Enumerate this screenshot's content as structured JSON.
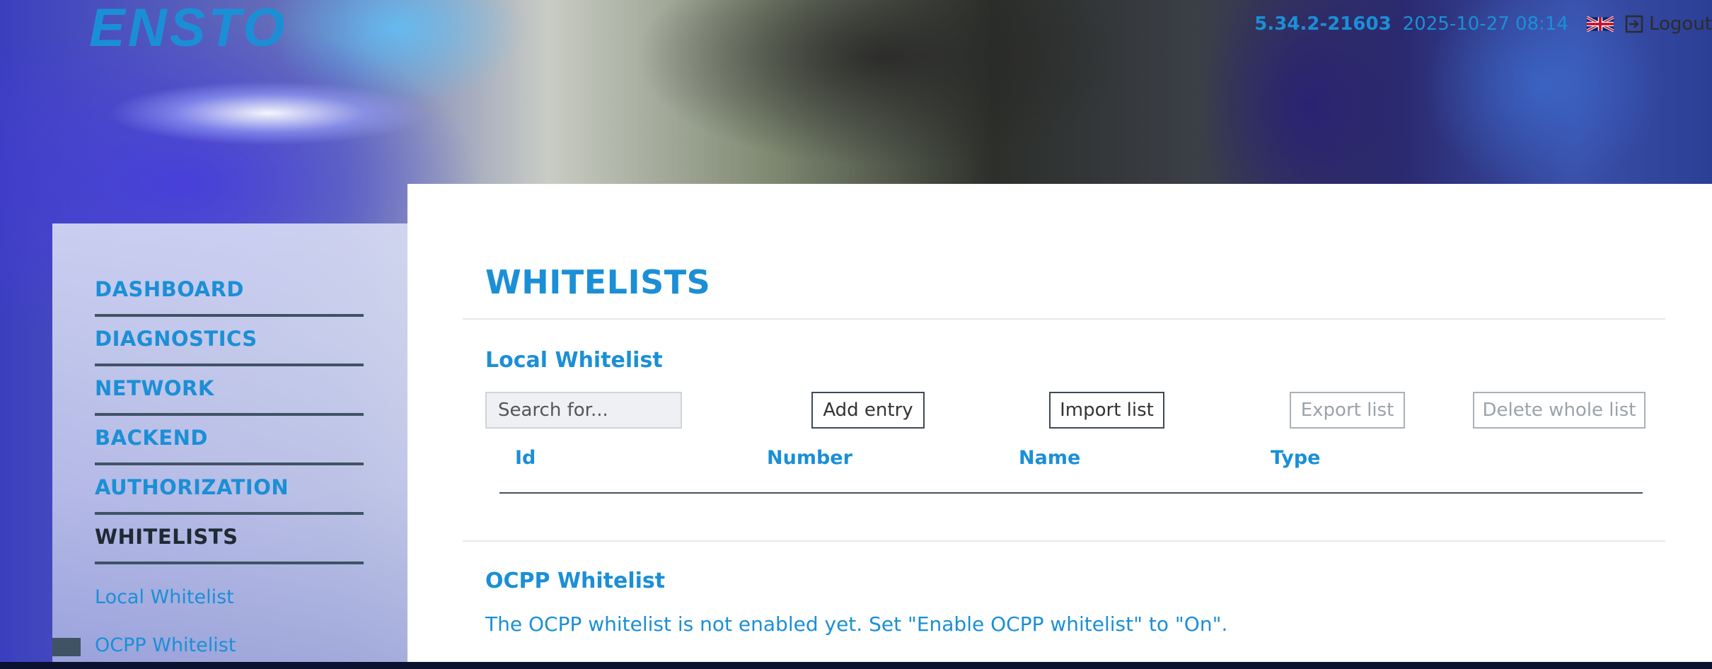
{
  "header": {
    "logo_text": "ENSTO",
    "version": "5.34.2-21603",
    "datetime": "2025-10-27 08:14",
    "language_icon": "uk-flag-icon",
    "logout_label": "Logout"
  },
  "sidebar": {
    "items": [
      {
        "label": "DASHBOARD",
        "active": false
      },
      {
        "label": "DIAGNOSTICS",
        "active": false
      },
      {
        "label": "NETWORK",
        "active": false
      },
      {
        "label": "BACKEND",
        "active": false
      },
      {
        "label": "AUTHORIZATION",
        "active": false
      },
      {
        "label": "WHITELISTS",
        "active": true
      }
    ],
    "sub_items": [
      {
        "label": "Local Whitelist"
      },
      {
        "label": "OCPP Whitelist"
      }
    ]
  },
  "main": {
    "title": "WHITELISTS",
    "local_whitelist": {
      "title": "Local Whitelist",
      "search_placeholder": "Search for...",
      "buttons": {
        "add_entry": "Add entry",
        "import_list": "Import list",
        "export_list": "Export list",
        "delete_whole_list": "Delete whole list"
      },
      "columns": [
        "Id",
        "Number",
        "Name",
        "Type"
      ]
    },
    "ocpp_whitelist": {
      "title": "OCPP Whitelist",
      "notice": "The OCPP whitelist is not enabled yet. Set \"Enable OCPP whitelist\" to \"On\"."
    }
  },
  "colors": {
    "accent": "#1b8fd6",
    "dark": "#3f5364"
  }
}
